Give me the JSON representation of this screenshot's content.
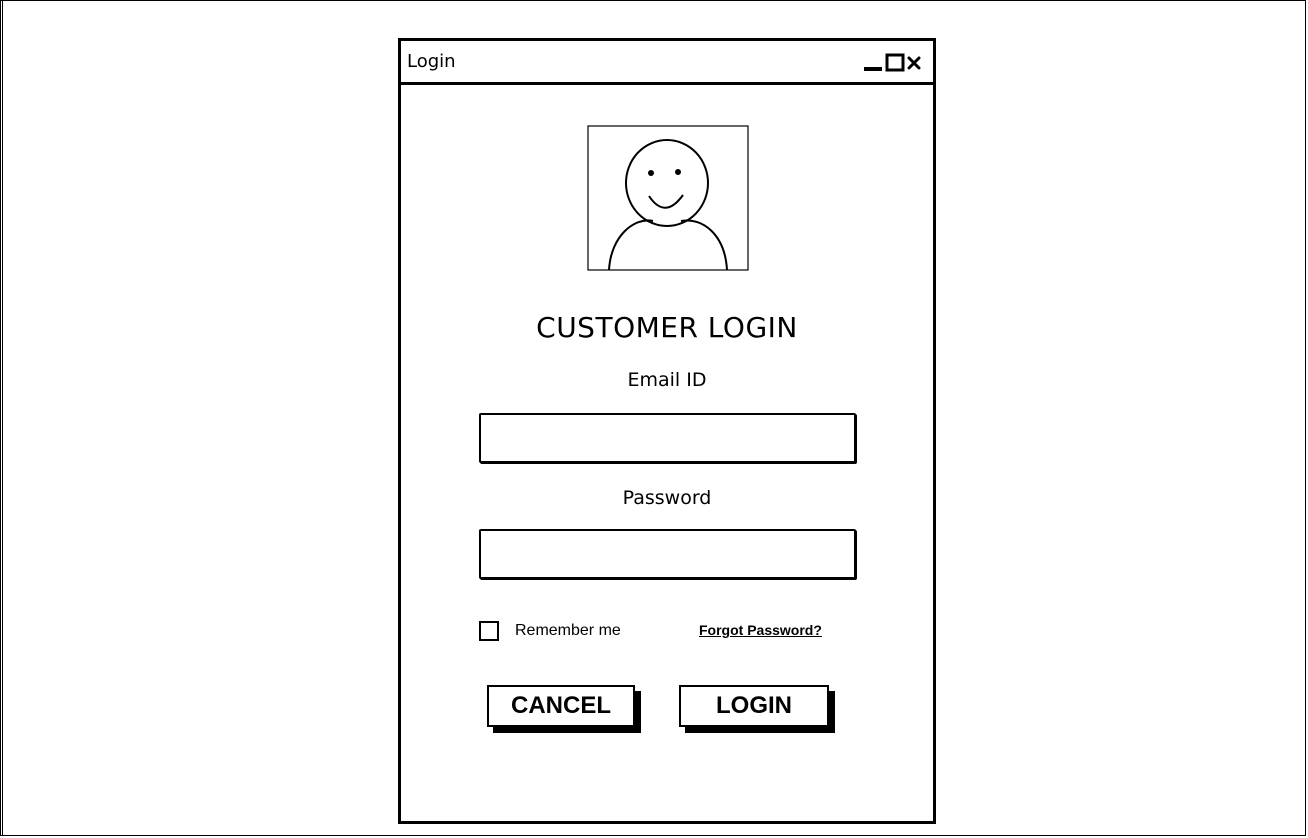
{
  "window": {
    "title": "Login"
  },
  "header": {
    "heading": "CUSTOMER LOGIN"
  },
  "form": {
    "email_label": "Email ID",
    "email_value": "",
    "password_label": "Password",
    "password_value": "",
    "remember_label": "Remember me",
    "remember_checked": false,
    "forgot_label": "Forgot Password?"
  },
  "buttons": {
    "cancel_label": "CANCEL",
    "login_label": "LOGIN"
  },
  "icons": {
    "avatar": "user-avatar-icon",
    "minimize": "minimize-icon",
    "maximize": "maximize-icon",
    "close": "close-icon"
  }
}
